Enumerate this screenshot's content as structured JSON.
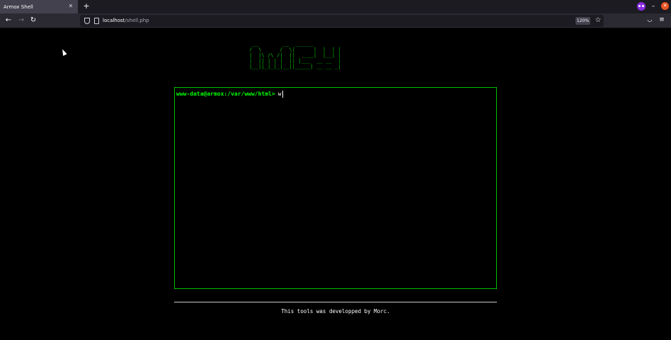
{
  "browser": {
    "tab": {
      "title": "Armox Shell"
    },
    "url": {
      "host": "localhost",
      "path": "/shell.php"
    },
    "zoom": "120%"
  },
  "page": {
    "banner": " __        __  ______             \n/  \\      /  \\|      |  |  | |   \n|  |\\ /\\ /|  ||  ____|  |__| |   \n|  || | | |  || |___  __ __  |   \n|__||_|_|_|__||_____| __ __ _|   ",
    "terminal": {
      "prompt": "www-data@armox:/var/www/html>",
      "input": "w"
    },
    "footer": "This tools was developped by Morc."
  }
}
